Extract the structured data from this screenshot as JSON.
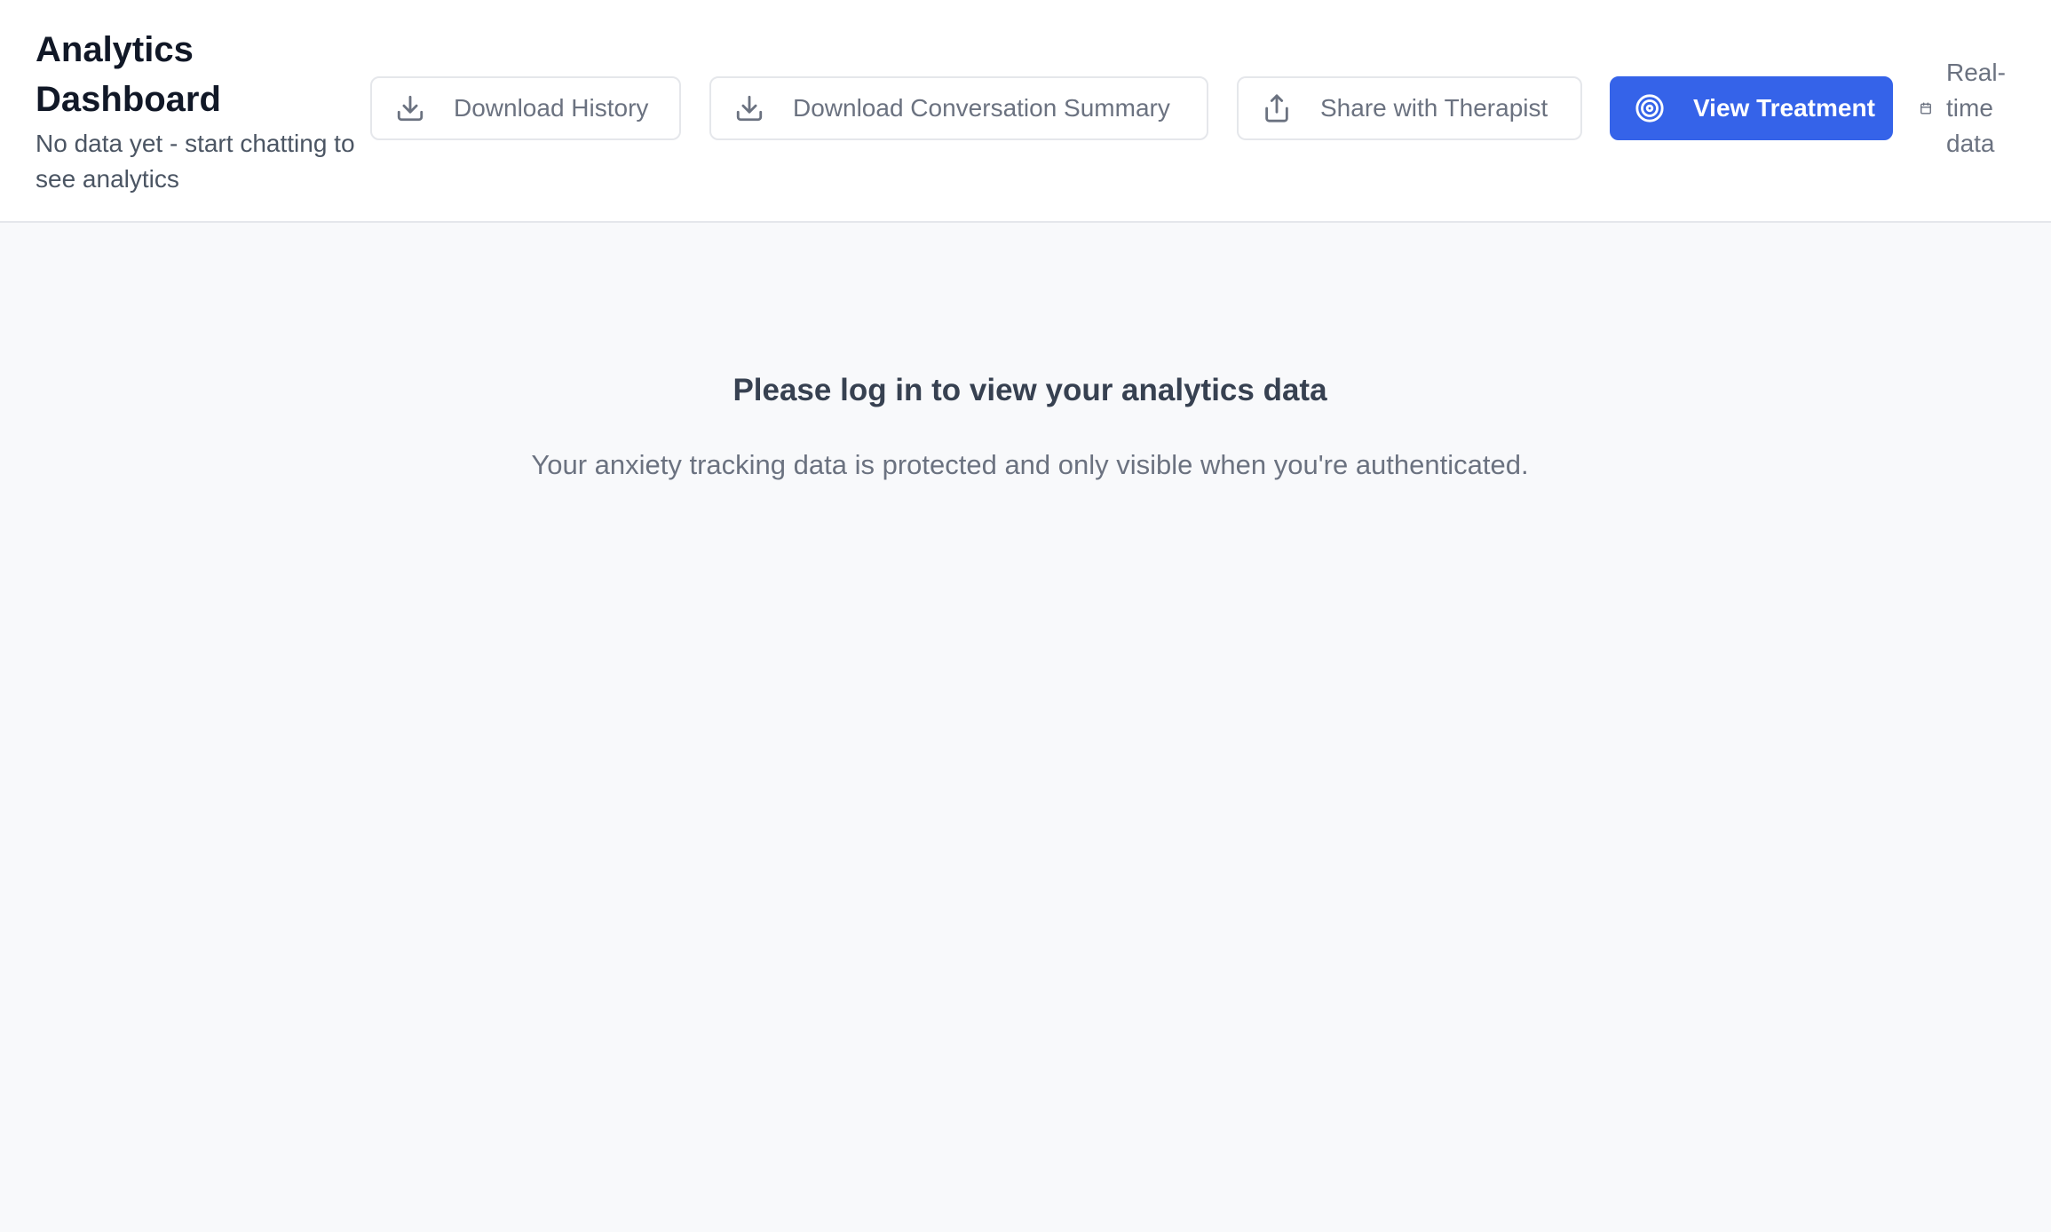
{
  "header": {
    "title": "Analytics Dashboard",
    "subtitle": "No data yet - start chatting to see analytics"
  },
  "toolbar": {
    "download_history": {
      "label": "Download History",
      "icon": "download-icon"
    },
    "download_summary": {
      "label": "Download Conversation Summary",
      "icon": "download-icon"
    },
    "share_therapist": {
      "label": "Share with Therapist",
      "icon": "share-icon"
    },
    "view_treatment": {
      "label": "View Treatment",
      "icon": "target-icon"
    }
  },
  "status": {
    "realtime_label": "Real-time data",
    "icon": "calendar-icon"
  },
  "main": {
    "login_title": "Please log in to view your analytics data",
    "login_description": "Your anxiety tracking data is protected and only visible when you're authenticated."
  },
  "colors": {
    "accent": "#3563e9",
    "background": "#f8f9fb",
    "header_background": "#ffffff",
    "title_text": "#111827",
    "muted_text": "#6b7280"
  }
}
